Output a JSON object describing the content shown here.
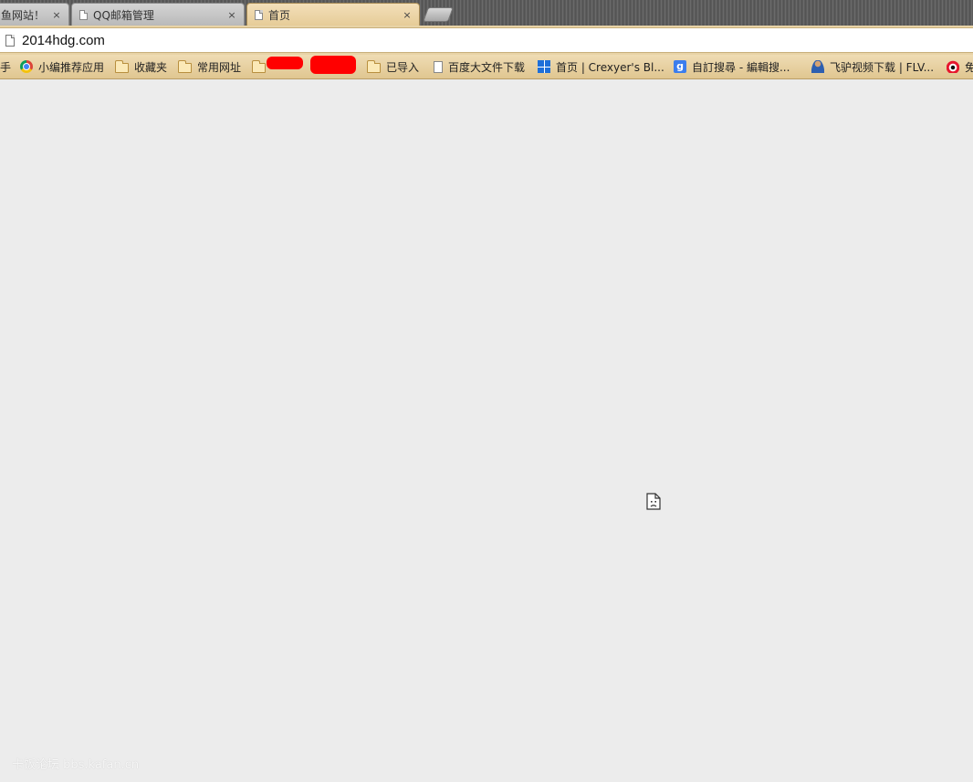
{
  "tabs": [
    {
      "title": "鱼网站！",
      "close": "×",
      "active": false
    },
    {
      "title": "QQ邮箱管理",
      "close": "×",
      "active": false
    },
    {
      "title": "首页",
      "close": "×",
      "active": true
    }
  ],
  "omnibox": {
    "url": "2014hdg.com"
  },
  "bookmarks": [
    {
      "label": "手",
      "icon": "none"
    },
    {
      "label": "小编推荐应用",
      "icon": "chrome-icon"
    },
    {
      "label": "收藏夹",
      "icon": "folder-icon"
    },
    {
      "label": "常用网址",
      "icon": "folder-icon"
    },
    {
      "label": "",
      "icon": "folder-icon"
    },
    {
      "label": "已导入",
      "icon": "folder-icon"
    },
    {
      "label": "百度大文件下载",
      "icon": "page-icon"
    },
    {
      "label": "首页 | Crexyer's Bl...",
      "icon": "grid-icon"
    },
    {
      "label": "自訂搜尋 - 編輯搜...",
      "icon": "google-icon"
    },
    {
      "label": "飞驴视频下载 | FLV...",
      "icon": "person-icon"
    },
    {
      "label": "免",
      "icon": "weibo-icon"
    }
  ],
  "content": {
    "icon": "sad-document-icon"
  },
  "watermark": "卡饭论坛 bbs.kafan.cn",
  "colors": {
    "accent": "#e8d3a6",
    "page_bg": "#ececec",
    "redaction": "#ff0000"
  }
}
